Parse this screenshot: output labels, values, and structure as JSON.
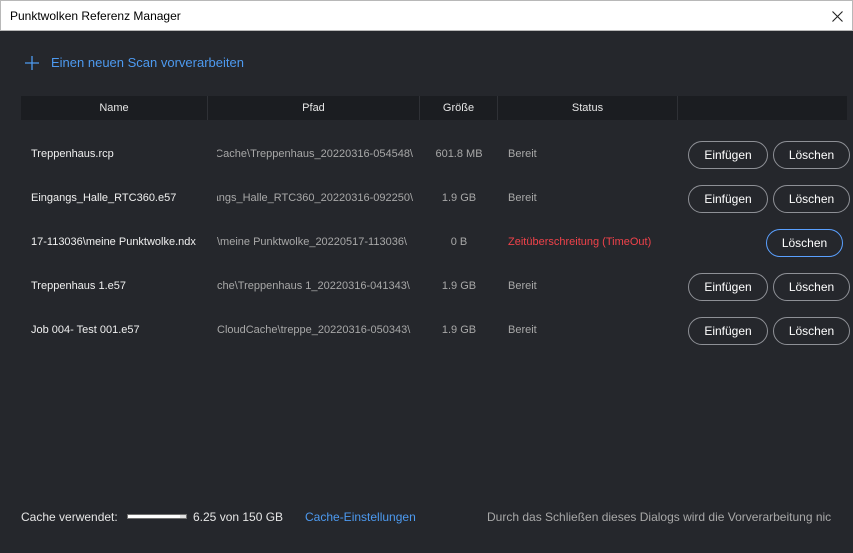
{
  "window": {
    "title": "Punktwolken Referenz Manager"
  },
  "actions": {
    "add_scan": "Einen neuen Scan vorverarbeiten"
  },
  "table": {
    "headers": [
      "Name",
      "Pfad",
      "Größe",
      "Status",
      ""
    ],
    "rows": [
      {
        "name": "Treppenhaus.rcp",
        "path": "Cache\\Treppenhaus_20220316-054548\\",
        "size": "601.8 MB",
        "status": "Bereit",
        "insert": "Einfügen",
        "delete": "Löschen"
      },
      {
        "name": "Eingangs_Halle_RTC360.e57",
        "path": "ngangs_Halle_RTC360_20220316-092250\\",
        "size": "1.9 GB",
        "status": "Bereit",
        "insert": "Einfügen",
        "delete": "Löschen"
      },
      {
        "name": "17-113036\\meine Punktwolke.ndx",
        "path": "\\meine Punktwolke_20220517-113036\\",
        "size": "0 B",
        "status": "Zeitüberschreitung (TimeOut)",
        "insert": "",
        "delete": "Löschen"
      },
      {
        "name": "Treppenhaus 1.e57",
        "path": "che\\Treppenhaus 1_20220316-041343\\",
        "size": "1.9 GB",
        "status": "Bereit",
        "insert": "Einfügen",
        "delete": "Löschen"
      },
      {
        "name": "Job 004- Test 001.e57",
        "path": "CloudCache\\treppe_20220316-050343\\",
        "size": "1.9 GB",
        "status": "Bereit",
        "insert": "Einfügen",
        "delete": "Löschen"
      }
    ]
  },
  "footer": {
    "cache_label": "Cache verwendet:",
    "cache_fraction": 0.042,
    "cache_value": "6.25 von 150 GB",
    "cache_settings": "Cache-Einstellungen",
    "hint": "Durch das Schließen dieses Dialogs wird die Vorverarbeitung nic"
  },
  "colors": {
    "accent": "#4d9af0",
    "error": "#f0424a",
    "background": "#25272c"
  }
}
